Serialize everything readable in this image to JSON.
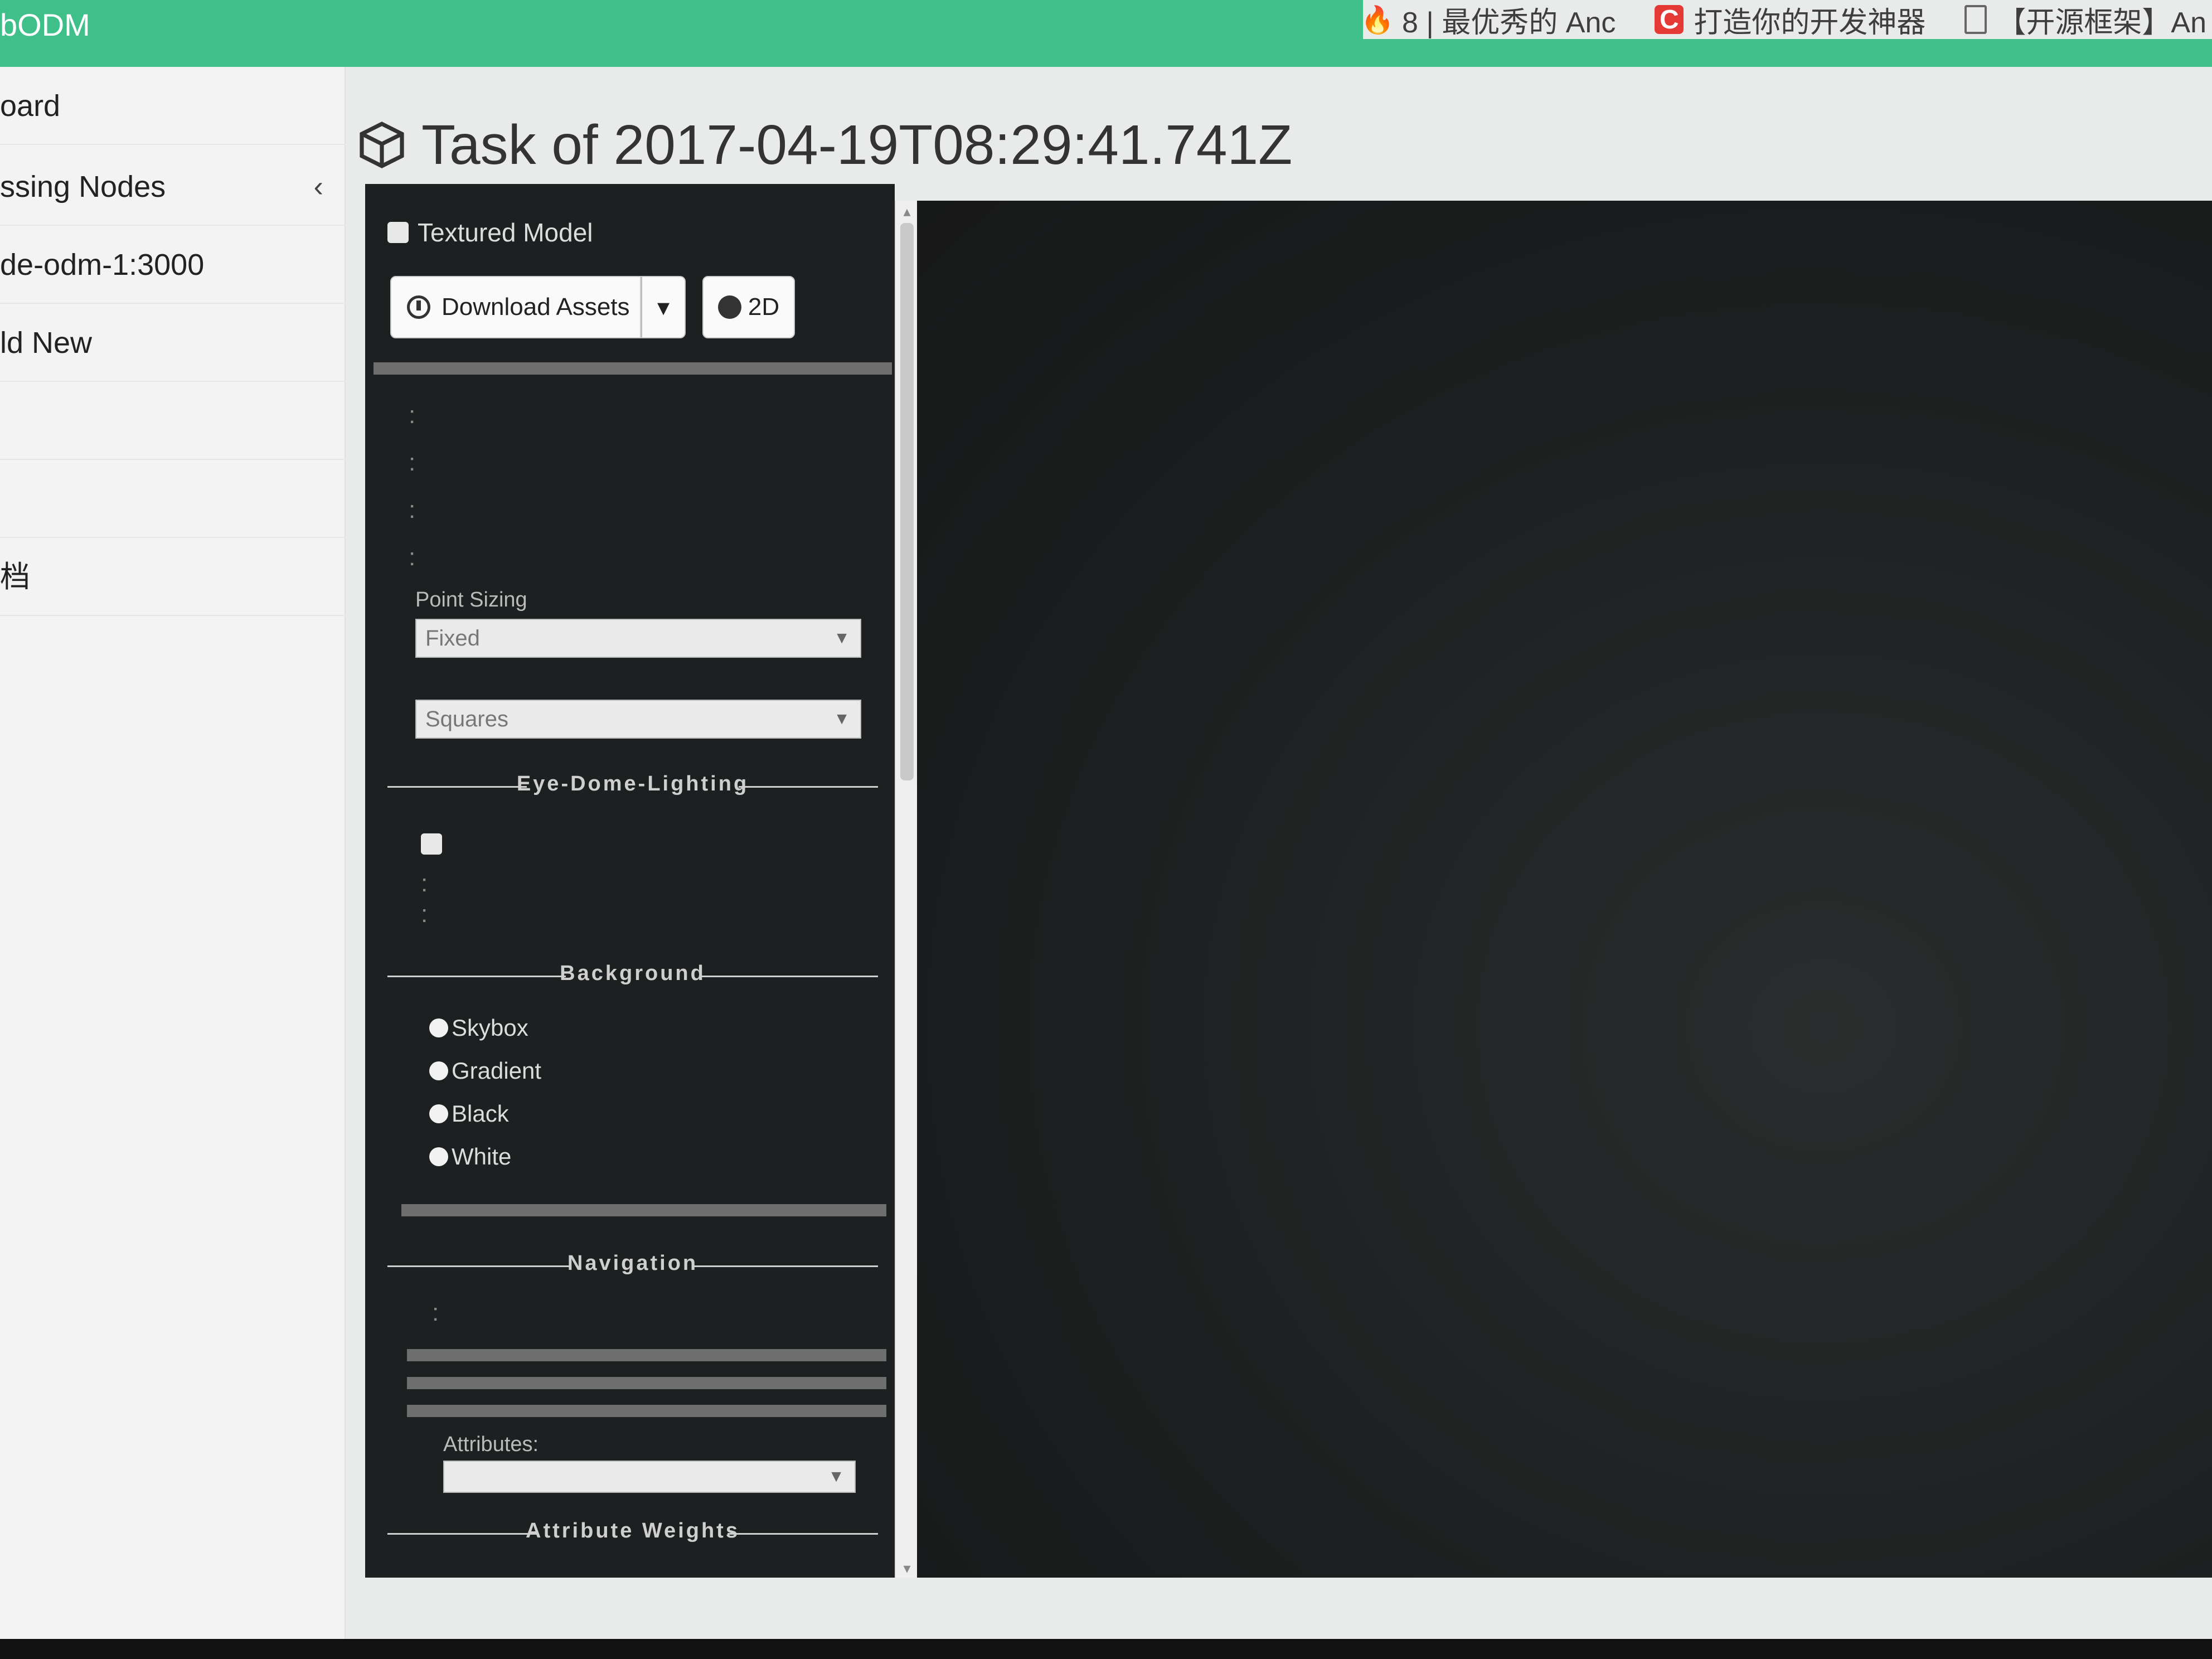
{
  "app": {
    "brand": "bODM"
  },
  "browser_tabs": [
    {
      "label": "8 | 最优秀的 Anc",
      "icon": "flame-icon"
    },
    {
      "label": "打造你的开发神器",
      "icon": "csdn-icon"
    },
    {
      "label": "【开源框架】An",
      "icon": "document-icon"
    }
  ],
  "sidebar": {
    "items": [
      {
        "label": "oard"
      },
      {
        "label": "ssing Nodes",
        "has_chevron": true,
        "chevron": "‹"
      },
      {
        "label": "de-odm-1:3000"
      },
      {
        "label": "ld New"
      },
      {
        "label": ""
      },
      {
        "label": ""
      },
      {
        "label": "档"
      }
    ]
  },
  "main": {
    "title": "Task of 2017-04-19T08:29:41.741Z"
  },
  "panel": {
    "textured_model_label": "Textured Model",
    "download_assets_label": "Download Assets",
    "caret": "▾",
    "btn_2d_label": "2D",
    "colon": ":",
    "point_sizing_label": "Point Sizing",
    "point_sizing_value": "Fixed",
    "shape_value": "Squares",
    "select_arrow": "▼",
    "eye_dome_header": "Eye-Dome-Lighting",
    "background_header": "Background",
    "background_options": [
      "Skybox",
      "Gradient",
      "Black",
      "White"
    ],
    "navigation_header": "Navigation",
    "attributes_label": "Attributes:",
    "attributes_value": "",
    "attribute_weights_header": "Attribute Weights"
  },
  "colors": {
    "nav_green": "#3fbf8a",
    "panel_bg": "#1d2021",
    "viewer_bg": "#1c1e1f"
  }
}
